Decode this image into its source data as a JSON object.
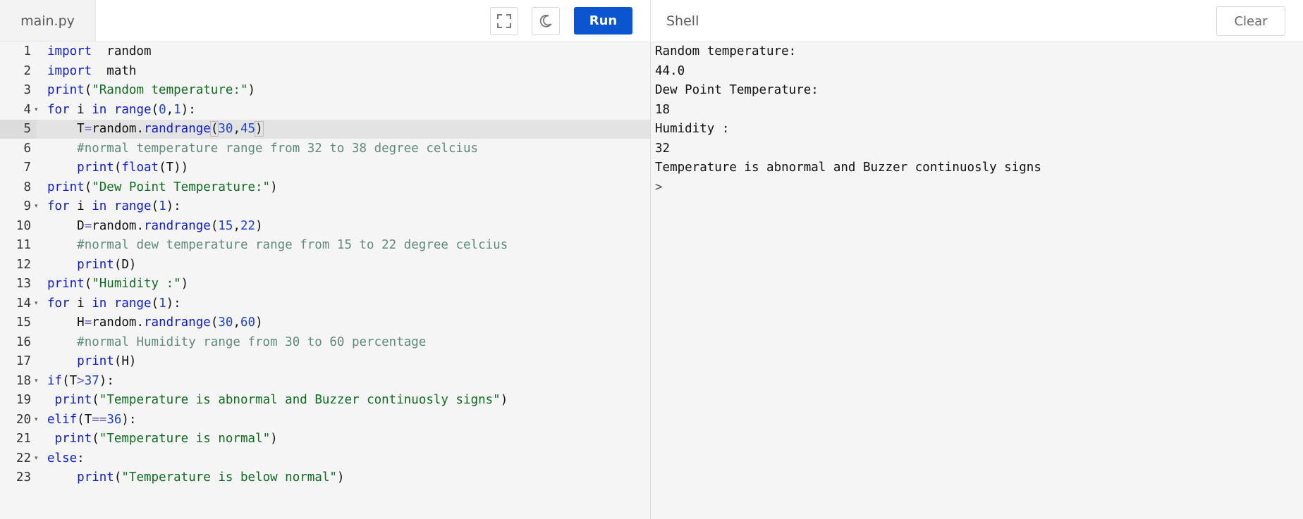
{
  "editor": {
    "file_tab": "main.py",
    "run_label": "Run",
    "code_lines": [
      {
        "n": "1",
        "fold": false,
        "active": false,
        "tokens": [
          [
            "kw",
            "import"
          ],
          [
            "",
            "  random"
          ]
        ]
      },
      {
        "n": "2",
        "fold": false,
        "active": false,
        "tokens": [
          [
            "kw",
            "import"
          ],
          [
            "",
            "  math"
          ]
        ]
      },
      {
        "n": "3",
        "fold": false,
        "active": false,
        "tokens": [
          [
            "fn",
            "print"
          ],
          [
            "",
            "("
          ],
          [
            "str",
            "\"Random temperature:\""
          ],
          [
            "",
            ")"
          ]
        ]
      },
      {
        "n": "4",
        "fold": true,
        "active": false,
        "tokens": [
          [
            "kw",
            "for"
          ],
          [
            "",
            " i "
          ],
          [
            "kw",
            "in"
          ],
          [
            "",
            " "
          ],
          [
            "fn",
            "range"
          ],
          [
            "",
            "("
          ],
          [
            "num",
            "0"
          ],
          [
            "",
            ","
          ],
          [
            "num",
            "1"
          ],
          [
            "",
            "):"
          ]
        ]
      },
      {
        "n": "5",
        "fold": false,
        "active": true,
        "tokens": [
          [
            "",
            "    T"
          ],
          [
            "op",
            "="
          ],
          [
            "",
            "random."
          ],
          [
            "fn",
            "randrange"
          ],
          [
            "br",
            "("
          ],
          [
            "num",
            "30"
          ],
          [
            "",
            ","
          ],
          [
            "num",
            "45"
          ],
          [
            "br",
            ")"
          ]
        ]
      },
      {
        "n": "6",
        "fold": false,
        "active": false,
        "tokens": [
          [
            "",
            "    "
          ],
          [
            "cm",
            "#normal temperature range from 32 to 38 degree celcius"
          ]
        ]
      },
      {
        "n": "7",
        "fold": false,
        "active": false,
        "tokens": [
          [
            "",
            "    "
          ],
          [
            "fn",
            "print"
          ],
          [
            "",
            "("
          ],
          [
            "fn",
            "float"
          ],
          [
            "",
            "(T))"
          ]
        ]
      },
      {
        "n": "8",
        "fold": false,
        "active": false,
        "tokens": [
          [
            "fn",
            "print"
          ],
          [
            "",
            "("
          ],
          [
            "str",
            "\"Dew Point Temperature:\""
          ],
          [
            "",
            ")"
          ]
        ]
      },
      {
        "n": "9",
        "fold": true,
        "active": false,
        "tokens": [
          [
            "kw",
            "for"
          ],
          [
            "",
            " i "
          ],
          [
            "kw",
            "in"
          ],
          [
            "",
            " "
          ],
          [
            "fn",
            "range"
          ],
          [
            "",
            "("
          ],
          [
            "num",
            "1"
          ],
          [
            "",
            "):"
          ]
        ]
      },
      {
        "n": "10",
        "fold": false,
        "active": false,
        "tokens": [
          [
            "",
            "    D"
          ],
          [
            "op",
            "="
          ],
          [
            "",
            "random."
          ],
          [
            "fn",
            "randrange"
          ],
          [
            "",
            "("
          ],
          [
            "num",
            "15"
          ],
          [
            "",
            ","
          ],
          [
            "num",
            "22"
          ],
          [
            "",
            ")"
          ]
        ]
      },
      {
        "n": "11",
        "fold": false,
        "active": false,
        "tokens": [
          [
            "",
            "    "
          ],
          [
            "cm",
            "#normal dew temperature range from 15 to 22 degree celcius"
          ]
        ]
      },
      {
        "n": "12",
        "fold": false,
        "active": false,
        "tokens": [
          [
            "",
            "    "
          ],
          [
            "fn",
            "print"
          ],
          [
            "",
            "(D)"
          ]
        ]
      },
      {
        "n": "13",
        "fold": false,
        "active": false,
        "tokens": [
          [
            "fn",
            "print"
          ],
          [
            "",
            "("
          ],
          [
            "str",
            "\"Humidity :\""
          ],
          [
            "",
            ")"
          ]
        ]
      },
      {
        "n": "14",
        "fold": true,
        "active": false,
        "tokens": [
          [
            "kw",
            "for"
          ],
          [
            "",
            " i "
          ],
          [
            "kw",
            "in"
          ],
          [
            "",
            " "
          ],
          [
            "fn",
            "range"
          ],
          [
            "",
            "("
          ],
          [
            "num",
            "1"
          ],
          [
            "",
            "):"
          ]
        ]
      },
      {
        "n": "15",
        "fold": false,
        "active": false,
        "tokens": [
          [
            "",
            "    H"
          ],
          [
            "op",
            "="
          ],
          [
            "",
            "random."
          ],
          [
            "fn",
            "randrange"
          ],
          [
            "",
            "("
          ],
          [
            "num",
            "30"
          ],
          [
            "",
            ","
          ],
          [
            "num",
            "60"
          ],
          [
            "",
            ")"
          ]
        ]
      },
      {
        "n": "16",
        "fold": false,
        "active": false,
        "tokens": [
          [
            "",
            "    "
          ],
          [
            "cm",
            "#normal Humidity range from 30 to 60 percentage"
          ]
        ]
      },
      {
        "n": "17",
        "fold": false,
        "active": false,
        "tokens": [
          [
            "",
            "    "
          ],
          [
            "fn",
            "print"
          ],
          [
            "",
            "(H)"
          ]
        ]
      },
      {
        "n": "18",
        "fold": true,
        "active": false,
        "tokens": [
          [
            "kw",
            "if"
          ],
          [
            "",
            "(T"
          ],
          [
            "op",
            ">"
          ],
          [
            "num",
            "37"
          ],
          [
            "",
            "):"
          ]
        ]
      },
      {
        "n": "19",
        "fold": false,
        "active": false,
        "tokens": [
          [
            "",
            " "
          ],
          [
            "fn",
            "print"
          ],
          [
            "",
            "("
          ],
          [
            "str",
            "\"Temperature is abnormal and Buzzer continuosly signs\""
          ],
          [
            "",
            ")"
          ]
        ]
      },
      {
        "n": "20",
        "fold": true,
        "active": false,
        "tokens": [
          [
            "kw",
            "elif"
          ],
          [
            "",
            "(T"
          ],
          [
            "op",
            "=="
          ],
          [
            "num",
            "36"
          ],
          [
            "",
            "):"
          ]
        ]
      },
      {
        "n": "21",
        "fold": false,
        "active": false,
        "tokens": [
          [
            "",
            " "
          ],
          [
            "fn",
            "print"
          ],
          [
            "",
            "("
          ],
          [
            "str",
            "\"Temperature is normal\""
          ],
          [
            "",
            ")"
          ]
        ]
      },
      {
        "n": "22",
        "fold": true,
        "active": false,
        "tokens": [
          [
            "kw",
            "else"
          ],
          [
            "",
            ":"
          ]
        ]
      },
      {
        "n": "23",
        "fold": false,
        "active": false,
        "tokens": [
          [
            "",
            "    "
          ],
          [
            "fn",
            "print"
          ],
          [
            "",
            "("
          ],
          [
            "str",
            "\"Temperature is below normal\""
          ],
          [
            "",
            ")"
          ]
        ]
      }
    ]
  },
  "toolbar": {
    "fullscreen_icon": "fullscreen-icon",
    "theme_icon": "moon-icon"
  },
  "shell": {
    "label": "Shell",
    "clear_label": "Clear",
    "output_lines": [
      "Random temperature:",
      "44.0",
      "Dew Point Temperature:",
      "18",
      "Humidity :",
      "32",
      "Temperature is abnormal and Buzzer continuosly signs"
    ],
    "prompt": ">"
  },
  "colors": {
    "run_button": "#0b55d0",
    "keyword": "#0c1bd6",
    "string": "#0f6b1f",
    "number": "#1f44c6",
    "comment": "#5f8a7a",
    "operator": "#6b5fb8"
  }
}
